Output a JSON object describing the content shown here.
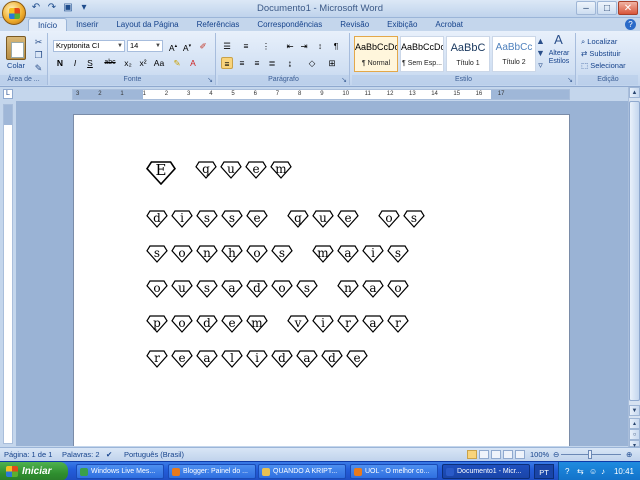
{
  "window": {
    "title": "Documento1 - Microsoft Word",
    "controls": [
      "minimize-icon",
      "maximize-icon",
      "close-icon"
    ]
  },
  "quick_access": [
    "undo-icon",
    "redo-icon",
    "save-icon",
    "customize-icon"
  ],
  "tabs": [
    {
      "label": "Início",
      "active": true
    },
    {
      "label": "Inserir"
    },
    {
      "label": "Layout da Página"
    },
    {
      "label": "Referências"
    },
    {
      "label": "Correspondências"
    },
    {
      "label": "Revisão"
    },
    {
      "label": "Exibição"
    },
    {
      "label": "Acrobat"
    }
  ],
  "ribbon": {
    "clipboard": {
      "paste_label": "Colar",
      "group_label": "Área de ..."
    },
    "font": {
      "font_name": "Kryptonita CI",
      "font_size": "14",
      "group_label": "Fonte",
      "buttons": [
        "N",
        "I",
        "S",
        "abc",
        "x₂",
        "x²",
        "Aa"
      ]
    },
    "paragraph": {
      "group_label": "Parágrafo",
      "alignment": "left"
    },
    "styles": {
      "group_label": "Estilo",
      "items": [
        {
          "sample": "AaBbCcDc",
          "name": "¶ Normal",
          "selected": true
        },
        {
          "sample": "AaBbCcDc",
          "name": "¶ Sem Esp..."
        },
        {
          "sample": "AaBbC",
          "name": "Título 1"
        },
        {
          "sample": "AaBbCc",
          "name": "Título 2"
        }
      ],
      "change_styles_label": "Alterar Estilos"
    },
    "editing": {
      "group_label": "Edição",
      "find_label": "Localizar",
      "replace_label": "Substituir",
      "select_label": "Selecionar"
    }
  },
  "ruler_numbers": [
    "3",
    "2",
    "1",
    "1",
    "2",
    "3",
    "4",
    "5",
    "6",
    "7",
    "8",
    "9",
    "10",
    "11",
    "12",
    "13",
    "14",
    "15",
    "16",
    "17"
  ],
  "document": {
    "lines": [
      [
        "E",
        "quem"
      ],
      [
        "disse",
        "que",
        "os"
      ],
      [
        "sonhos",
        "mais"
      ],
      [
        "ousados",
        "nao"
      ],
      [
        "podem",
        "virar"
      ],
      [
        "realidade"
      ]
    ]
  },
  "status": {
    "page": "Página: 1 de 1",
    "words": "Palavras: 2",
    "language": "Português (Brasil)",
    "zoom": "100%"
  },
  "taskbar": {
    "start_label": "Iniciar",
    "tasks": [
      {
        "label": "Windows Live Mes...",
        "icon": "messenger-icon",
        "color": "#3aa04a"
      },
      {
        "label": "Blogger: Painel do ...",
        "icon": "firefox-icon",
        "color": "#e87a1c"
      },
      {
        "label": "QUANDO A KRIPT...",
        "icon": "folder-icon",
        "color": "#e8c050"
      },
      {
        "label": "UOL - O melhor co...",
        "icon": "firefox-icon",
        "color": "#e87a1c"
      },
      {
        "label": "Documento1 - Micr...",
        "icon": "word-icon",
        "color": "#2a5ac8",
        "active": true
      }
    ],
    "language": "PT",
    "clock": "10:41"
  }
}
